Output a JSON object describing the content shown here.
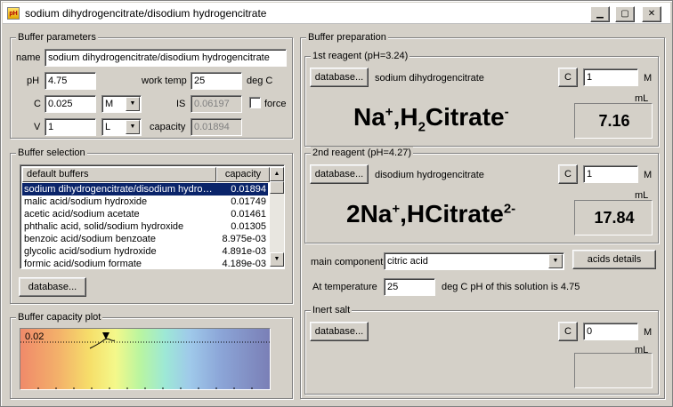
{
  "window": {
    "title": "sodium dihydrogencitrate/disodium hydrogencitrate",
    "app_icon_text": "pH"
  },
  "buffer_parameters": {
    "legend": "Buffer parameters",
    "name_label": "name",
    "name_value": "sodium dihydrogencitrate/disodium hydrogencitrate",
    "ph_label": "pH",
    "ph_value": "4.75",
    "work_temp_label": "work temp",
    "work_temp_value": "25",
    "work_temp_unit": "deg C",
    "c_label": "C",
    "c_value": "0.025",
    "c_unit": "M",
    "is_label": "IS",
    "is_value": "0.06197",
    "force_label": "force",
    "force_checked": false,
    "v_label": "V",
    "v_value": "1",
    "v_unit": "L",
    "capacity_label": "capacity",
    "capacity_value": "0.01894"
  },
  "buffer_selection": {
    "legend": "Buffer selection",
    "columns": [
      "default buffers",
      "capacity"
    ],
    "rows": [
      {
        "name": "sodium dihydrogencitrate/disodium hydroge...",
        "capacity": "0.01894",
        "selected": true
      },
      {
        "name": "malic acid/sodium hydroxide",
        "capacity": "0.01749"
      },
      {
        "name": "acetic acid/sodium acetate",
        "capacity": "0.01461"
      },
      {
        "name": "phthalic acid, solid/sodium hydroxide",
        "capacity": "0.01305"
      },
      {
        "name": "benzoic acid/sodium benzoate",
        "capacity": "8.975e-03"
      },
      {
        "name": "glycolic acid/sodium hydroxide",
        "capacity": "4.891e-03"
      },
      {
        "name": "formic acid/sodium formate",
        "capacity": "4.189e-03"
      }
    ],
    "database_button": "database..."
  },
  "capacity_plot": {
    "legend": "Buffer capacity plot",
    "y_label": "0.02"
  },
  "buffer_preparation": {
    "legend": "Buffer preparation",
    "reagent1": {
      "legend": "1st reagent (pH=3.24)",
      "database_button": "database...",
      "name": "sodium dihydrogencitrate",
      "c_button": "C",
      "conc_value": "1",
      "conc_unit": "M",
      "ml_label": "mL",
      "volume": "7.16",
      "formula_a": "Na",
      "formula_a_sup": "+",
      "formula_sep": ",H",
      "formula_sub": "2",
      "formula_b": "Citrate",
      "formula_b_sup": "-"
    },
    "reagent2": {
      "legend": "2nd reagent (pH=4.27)",
      "database_button": "database...",
      "name": "disodium hydrogencitrate",
      "c_button": "C",
      "conc_value": "1",
      "conc_unit": "M",
      "ml_label": "mL",
      "volume": "17.84",
      "formula_a": "2Na",
      "formula_a_sup": "+",
      "formula_b": ",HCitrate",
      "formula_b_sup": "2-"
    },
    "main_component_label": "main component",
    "main_component_value": "citric acid",
    "acids_details_button": "acids details",
    "at_temperature_label": "At temperature",
    "temperature_value": "25",
    "temperature_text": "deg C pH of this solution is 4.75",
    "inert_salt": {
      "legend": "Inert salt",
      "database_button": "database...",
      "c_button": "C",
      "conc_value": "0",
      "conc_unit": "M",
      "ml_label": "mL"
    }
  }
}
